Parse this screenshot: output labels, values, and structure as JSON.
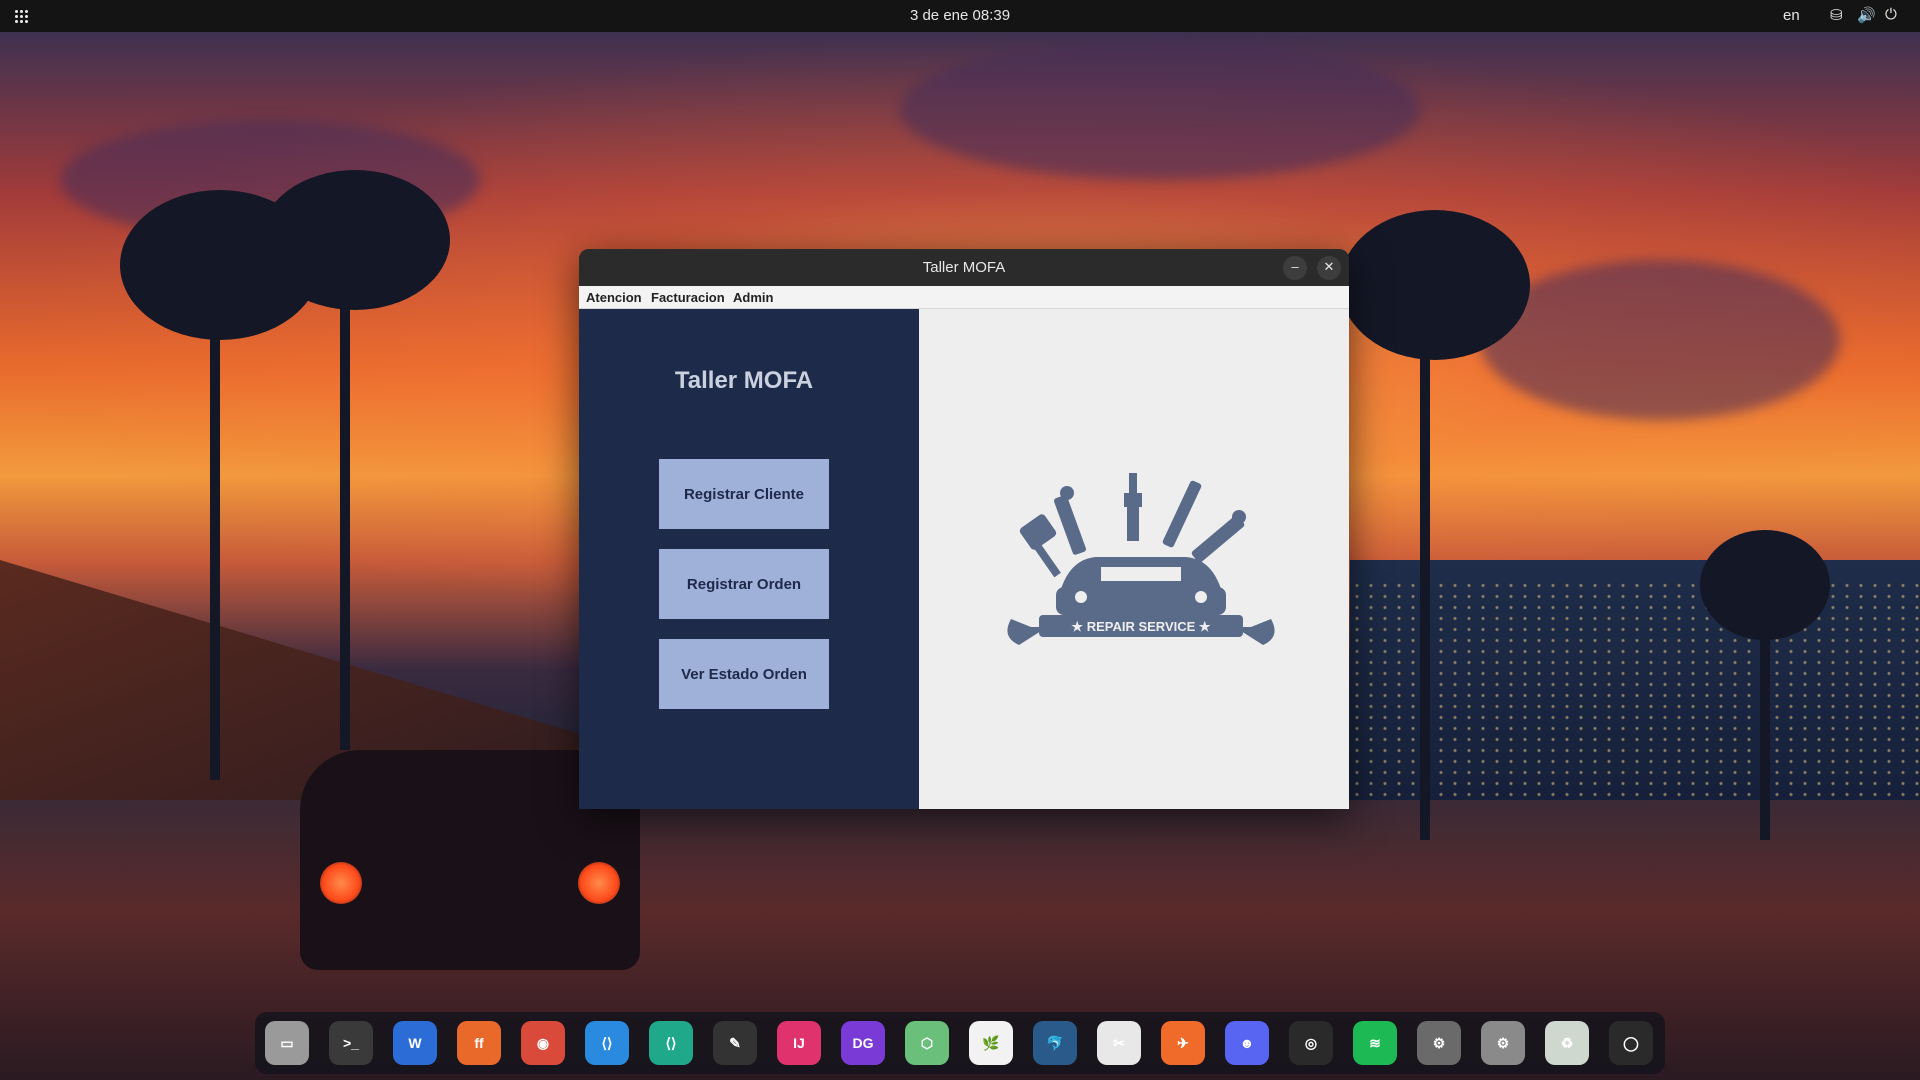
{
  "topbar": {
    "clock": "3 de ene  08:39",
    "lang": "en",
    "icons": [
      "apps-grid-icon",
      "network-icon",
      "volume-icon",
      "power-icon"
    ]
  },
  "window": {
    "title": "Taller MOFA",
    "minimize": "–",
    "close": "✕",
    "menu": [
      "Atencion",
      "Facturacion",
      "Admin"
    ],
    "panel_title": "Taller MOFA",
    "buttons": [
      "Registrar Cliente",
      "Registrar Orden",
      "Ver Estado Orden"
    ],
    "logo_text": "★ REPAIR SERVICE ★",
    "colors": {
      "left_panel": "#1e2a4a",
      "button": "#9fb0d9",
      "logo": "#5a6b8a"
    }
  },
  "dock": {
    "apps": [
      {
        "name": "files",
        "glyph": "▭",
        "color": "#9a9a9a"
      },
      {
        "name": "terminal",
        "glyph": ">_",
        "color": "#3a3a3a"
      },
      {
        "name": "libreoffice-writer",
        "glyph": "W",
        "color": "#2b6cd6"
      },
      {
        "name": "firefox",
        "glyph": "ff",
        "color": "#e8692a"
      },
      {
        "name": "chrome",
        "glyph": "◉",
        "color": "#d94a3a"
      },
      {
        "name": "vscode",
        "glyph": "⟨⟩",
        "color": "#2a8ae0"
      },
      {
        "name": "vs-insiders",
        "glyph": "⟨⟩",
        "color": "#1fa88a"
      },
      {
        "name": "text-editor",
        "glyph": "✎",
        "color": "#333"
      },
      {
        "name": "intellij",
        "glyph": "IJ",
        "color": "#e0336e"
      },
      {
        "name": "datagrip",
        "glyph": "DG",
        "color": "#7a3ad6"
      },
      {
        "name": "cube-app",
        "glyph": "⬡",
        "color": "#6abf7a"
      },
      {
        "name": "mongodb-compass",
        "glyph": "🌿",
        "color": "#f2f2f2"
      },
      {
        "name": "mysql-workbench",
        "glyph": "🐬",
        "color": "#2a5a8a"
      },
      {
        "name": "gimp",
        "glyph": "✂",
        "color": "#e8e8e8"
      },
      {
        "name": "postman",
        "glyph": "✈",
        "color": "#f06a2a"
      },
      {
        "name": "discord",
        "glyph": "☻",
        "color": "#5865f2"
      },
      {
        "name": "obs",
        "glyph": "◎",
        "color": "#2a2a2a"
      },
      {
        "name": "spotify",
        "glyph": "≋",
        "color": "#1db954"
      },
      {
        "name": "settings-gear",
        "glyph": "⚙",
        "color": "#6a6a6a"
      },
      {
        "name": "java-app",
        "glyph": "⚙",
        "color": "#8a8a8a"
      },
      {
        "name": "trash",
        "glyph": "♻",
        "color": "#cfd8cf"
      },
      {
        "name": "ubuntu-menu",
        "glyph": "◯",
        "color": "#2a2a2a"
      }
    ]
  }
}
